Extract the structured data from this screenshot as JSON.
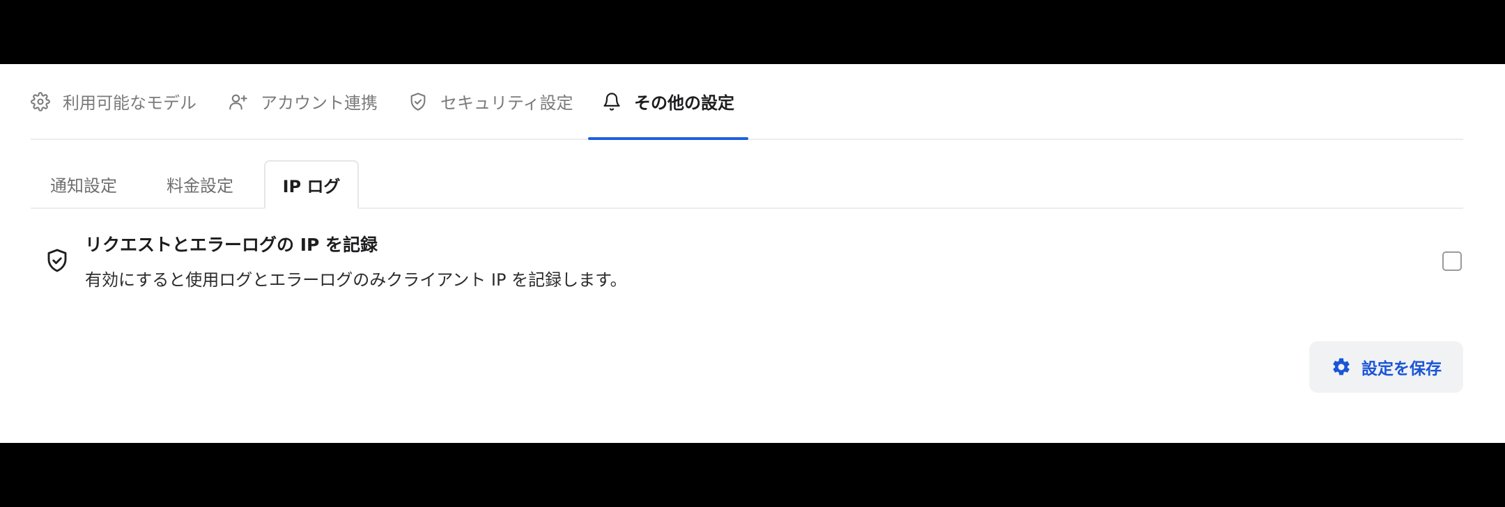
{
  "top_tabs": [
    {
      "label": "利用可能なモデル",
      "icon": "gear-icon",
      "active": false
    },
    {
      "label": "アカウント連携",
      "icon": "user-plus-icon",
      "active": false
    },
    {
      "label": "セキュリティ設定",
      "icon": "shield-check-icon",
      "active": false
    },
    {
      "label": "その他の設定",
      "icon": "bell-icon",
      "active": true
    }
  ],
  "sub_tabs": [
    {
      "label": "通知設定",
      "active": false
    },
    {
      "label": "料金設定",
      "active": false
    },
    {
      "label": "IP ログ",
      "active": true
    }
  ],
  "setting": {
    "title": "リクエストとエラーログの IP を記録",
    "description": "有効にすると使用ログとエラーログのみクライアント IP を記録します。",
    "checked": false,
    "icon": "shield-check-icon"
  },
  "save_button": {
    "label": "設定を保存",
    "icon": "gear-icon"
  },
  "colors": {
    "accent": "#1f5fe0",
    "button_text": "#1a55d6",
    "button_bg": "#f1f2f4"
  }
}
